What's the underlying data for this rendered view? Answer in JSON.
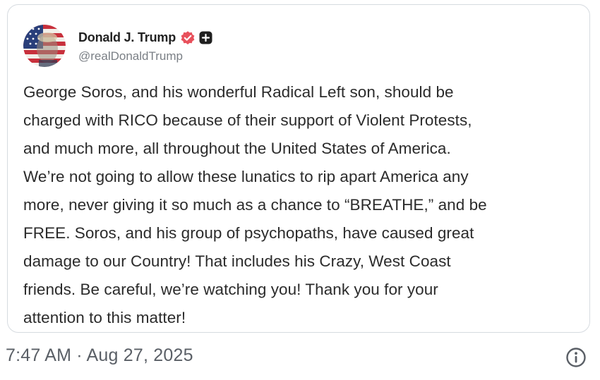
{
  "post": {
    "author": {
      "display_name": "Donald J. Trump",
      "handle": "@realDonaldTrump",
      "verified_badge_icon": "verified-badge-icon",
      "plus_badge_icon": "plus-badge-icon"
    },
    "text_lines": [
      "George Soros, and his wonderful Radical Left son, should be",
      "charged with RICO because of their support of Violent Protests,",
      "and much more, all throughout the United States of America.",
      "We’re not going to allow these lunatics to rip apart America any",
      "more, never giving it so much as a chance to “BREATHE,” and be",
      "FREE. Soros, and his group of psychopaths, have caused great",
      "damage to our Country! That includes his Crazy, West Coast",
      "friends. Be careful, we’re watching you! Thank you for your",
      "attention to this matter!"
    ]
  },
  "footer": {
    "timestamp": "7:47 AM · Aug 27, 2025",
    "info_icon": "info-icon"
  },
  "colors": {
    "verified_badge": "#e8505b",
    "border": "#d6dbe0",
    "text": "#2b2b2b",
    "muted": "#7a7f85"
  }
}
